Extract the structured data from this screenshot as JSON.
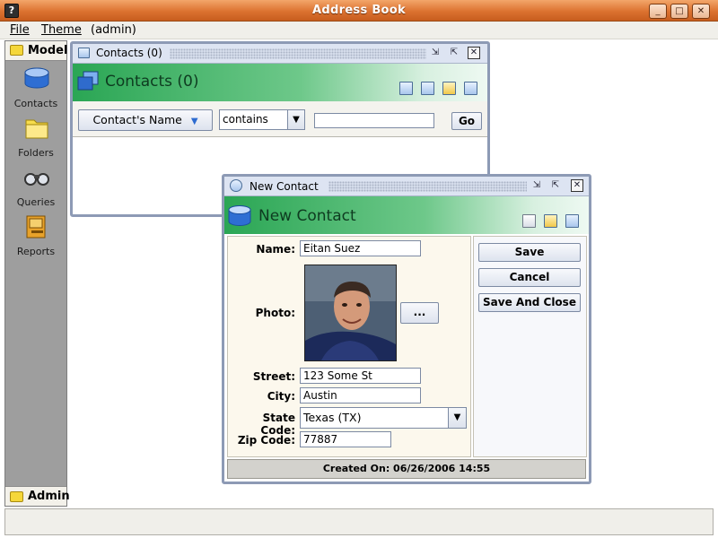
{
  "window": {
    "title": "Address Book",
    "app_icon": "?",
    "buttons": [
      "_",
      "□",
      "X"
    ]
  },
  "menubar": {
    "items": [
      {
        "label": "File"
      },
      {
        "label": "Theme"
      },
      {
        "label": "(admin)"
      }
    ]
  },
  "sidebar": {
    "header": "Model",
    "items": [
      {
        "label": "Contacts"
      },
      {
        "label": "Folders"
      },
      {
        "label": "Queries"
      },
      {
        "label": "Reports"
      }
    ],
    "footer": "Admin"
  },
  "contacts_frame": {
    "title": "Contacts (0)",
    "banner_title": "Contacts (0)",
    "filter": {
      "field": "Contact's Name",
      "operator": "contains",
      "value": "",
      "go_label": "Go"
    }
  },
  "new_contact": {
    "title": "New Contact",
    "banner_title": "New Contact",
    "form": {
      "name_label": "Name:",
      "name_value": "Eitan Suez",
      "photo_label": "Photo:",
      "browse_label": "...",
      "street_label": "Street:",
      "street_value": "123 Some St",
      "city_label": "City:",
      "city_value": "Austin",
      "state_label": "State Code:",
      "state_value": "Texas (TX)",
      "zip_label": "Zip Code:",
      "zip_value": "77887"
    },
    "actions": {
      "save": "Save",
      "cancel": "Cancel",
      "save_close": "Save And Close"
    },
    "footer": "Created On: 06/26/2006 14:55"
  },
  "colors": {
    "titlebar": "#dc7230",
    "banner": "#2aa654",
    "frame_border": "#8d9ab5",
    "sidebar": "#9e9e9e"
  }
}
